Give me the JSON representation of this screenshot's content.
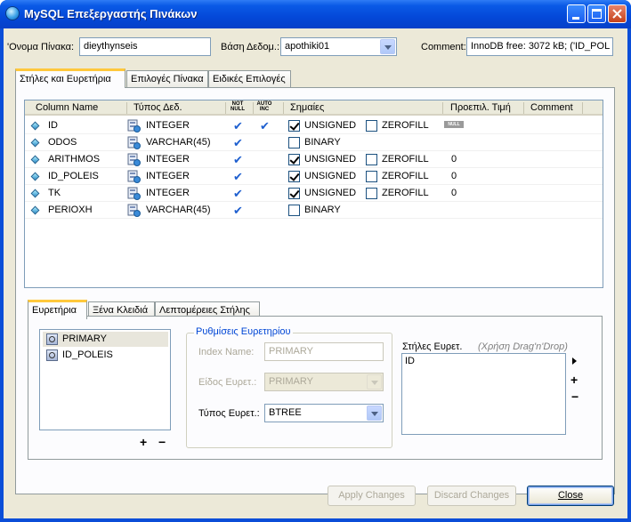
{
  "window": {
    "title": "MySQL Επεξεργαστής Πινάκων"
  },
  "top": {
    "table_name_label": "'Ονομα Πίνακα:",
    "table_name_value": "dieythynseis",
    "database_label": "Βάση Δεδομ.:",
    "database_value": "apothiki01",
    "comment_label": "Comment:",
    "comment_value": "InnoDB free: 3072 kB; ('ID_POL"
  },
  "main_tabs": [
    {
      "label": "Στήλες και Ευρετήρια",
      "active": true
    },
    {
      "label": "Επιλογές Πίνακα",
      "active": false
    },
    {
      "label": "Ειδικές Επιλογές",
      "active": false
    }
  ],
  "grid": {
    "headers": {
      "column_name": "Column Name",
      "type": "Τύπος Δεδ.",
      "not_null_1": "NOT",
      "not_null_2": "NULL",
      "auto_inc_1": "AUTO",
      "auto_inc_2": "INC",
      "flags": "Σημαίες",
      "default": "Προεπιλ. Τιμή",
      "comment": "Comment"
    },
    "rows": [
      {
        "name": "ID",
        "type": "INTEGER",
        "not_null": true,
        "auto_inc": true,
        "flag1": "UNSIGNED",
        "flag1_on": true,
        "flag2": "ZEROFILL",
        "flag2_on": false,
        "default": "",
        "null_badge": "NULL"
      },
      {
        "name": "ODOS",
        "type": "VARCHAR(45)",
        "not_null": true,
        "auto_inc": false,
        "flag1": "BINARY",
        "flag1_on": false,
        "flag2": "",
        "flag2_on": false,
        "default": "",
        "null_badge": ""
      },
      {
        "name": "ARITHMOS",
        "type": "INTEGER",
        "not_null": true,
        "auto_inc": false,
        "flag1": "UNSIGNED",
        "flag1_on": true,
        "flag2": "ZEROFILL",
        "flag2_on": false,
        "default": "0",
        "null_badge": ""
      },
      {
        "name": "ID_POLEIS",
        "type": "INTEGER",
        "not_null": true,
        "auto_inc": false,
        "flag1": "UNSIGNED",
        "flag1_on": true,
        "flag2": "ZEROFILL",
        "flag2_on": false,
        "default": "0",
        "null_badge": ""
      },
      {
        "name": "TK",
        "type": "INTEGER",
        "not_null": true,
        "auto_inc": false,
        "flag1": "UNSIGNED",
        "flag1_on": true,
        "flag2": "ZEROFILL",
        "flag2_on": false,
        "default": "0",
        "null_badge": ""
      },
      {
        "name": "PERIOXH",
        "type": "VARCHAR(45)",
        "not_null": true,
        "auto_inc": false,
        "flag1": "BINARY",
        "flag1_on": false,
        "flag2": "",
        "flag2_on": false,
        "default": "",
        "null_badge": ""
      }
    ]
  },
  "lower_tabs": [
    {
      "label": "Ευρετήρια",
      "active": true
    },
    {
      "label": "Ξένα Κλειδιά",
      "active": false
    },
    {
      "label": "Λεπτομέρειες Στήλης",
      "active": false
    }
  ],
  "indices": {
    "items": [
      "PRIMARY",
      "ID_POLEIS"
    ],
    "selected": "PRIMARY",
    "add_symbol": "+",
    "remove_symbol": "−"
  },
  "index_settings": {
    "group_title": "Ρυθμίσεις Ευρετηρίου",
    "index_name_label": "Index Name:",
    "index_name_value": "PRIMARY",
    "index_kind_label": "Είδος Ευρετ.:",
    "index_kind_value": "PRIMARY",
    "index_type_label": "Τύπος Ευρετ.:",
    "index_type_value": "BTREE"
  },
  "index_columns": {
    "label": "Στήλες Ευρετ.",
    "hint": "(Χρήση Drag'n'Drop)",
    "items": [
      "ID"
    ],
    "add_symbol": "+",
    "remove_symbol": "−"
  },
  "buttons": {
    "apply": "Apply Changes",
    "discard": "Discard Changes",
    "close": "Close"
  }
}
